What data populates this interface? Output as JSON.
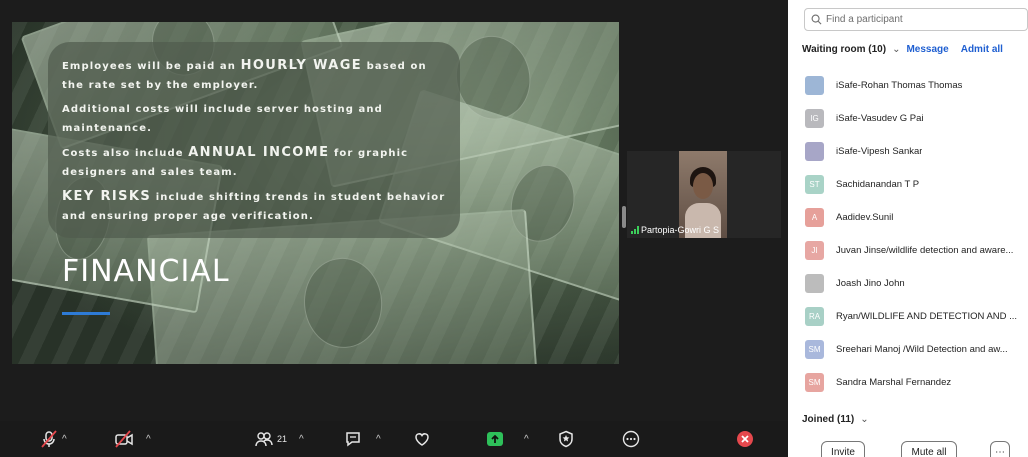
{
  "slide": {
    "points": [
      {
        "pre": "Employees will be paid an ",
        "bold": "HOURLY WAGE",
        "post": " based on the rate set by the employer."
      },
      {
        "pre": "Additional costs will include server hosting and maintenance.",
        "bold": "",
        "post": ""
      },
      {
        "pre": "Costs also include ",
        "bold": "ANNUAL INCOME",
        "post": " for graphic designers and sales team."
      },
      {
        "pre": "",
        "bold": "KEY RISKS",
        "post": " include shifting trends in student behavior and ensuring proper age verification."
      }
    ],
    "title": "FINANCIAL",
    "accent": "#2e7bd6"
  },
  "video": {
    "name": "Partopia-Gowri G S",
    "signal_color": "#3ccf5a"
  },
  "toolbar": {
    "participants_count": "21",
    "icons": [
      "mic-muted-icon",
      "video-off-icon",
      "participants-icon",
      "chat-icon",
      "reactions-icon",
      "share-screen-icon",
      "security-icon",
      "more-icon",
      "end-icon"
    ]
  },
  "panel": {
    "search_placeholder": "Find a participant",
    "waiting_label": "Waiting room (10)",
    "message_label": "Message",
    "admit_all_label": "Admit all",
    "link_color": "#1f5fd1",
    "waiting": [
      {
        "initials": "",
        "name": "iSafe-Rohan Thomas Thomas",
        "color": "#9db6d6",
        "kind": "image"
      },
      {
        "initials": "IG",
        "name": "iSafe-Vasudev G Pai",
        "color": "#b9b9bd"
      },
      {
        "initials": "",
        "name": "iSafe-Vipesh Sankar",
        "color": "#a7a6c7",
        "kind": "image"
      },
      {
        "initials": "ST",
        "name": "Sachidanandan T P",
        "color": "#a9d3c7"
      },
      {
        "initials": "A",
        "name": "Aadidev.Sunil",
        "color": "#e6a09a"
      },
      {
        "initials": "JI",
        "name": "Juvan Jinse/wildlife detection and aware...",
        "color": "#e7a7a3"
      },
      {
        "initials": "",
        "name": "Joash Jino John",
        "color": "#bcbcbc",
        "kind": "image"
      },
      {
        "initials": "RA",
        "name": "Ryan/WILDLIFE AND DETECTION AND ...",
        "color": "#a8d0c6"
      },
      {
        "initials": "SM",
        "name": "Sreehari Manoj /Wild Detection and aw...",
        "color": "#a9b8dc"
      },
      {
        "initials": "SM",
        "name": "Sandra Marshal Fernandez",
        "color": "#e7a5a0"
      }
    ],
    "joined_label": "Joined (11)",
    "invite_label": "Invite",
    "mute_all_label": "Mute all",
    "more_label": "⋯"
  }
}
